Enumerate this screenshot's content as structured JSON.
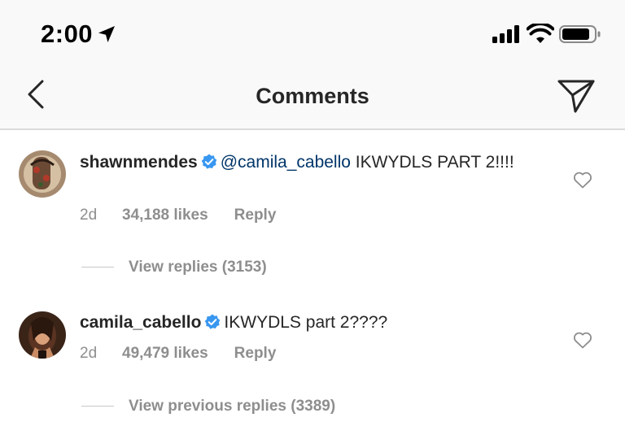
{
  "status_bar": {
    "time": "2:00",
    "icons": [
      "location-arrow-icon",
      "signal-bars-icon",
      "wifi-icon",
      "battery-icon"
    ]
  },
  "header": {
    "title": "Comments",
    "back_icon": "chevron-left-icon",
    "send_icon": "paper-plane-icon"
  },
  "comments": [
    {
      "username": "shawnmendes",
      "verified": true,
      "mention": "@camila_cabello",
      "text": " IKWYDLS PART 2!!!!",
      "age": "2d",
      "likes": "34,188 likes",
      "reply_label": "Reply",
      "replies_label": "View replies (3153)"
    },
    {
      "username": "camila_cabello",
      "verified": true,
      "mention": "",
      "text": "IKWYDLS part 2????",
      "age": "2d",
      "likes": "49,479 likes",
      "reply_label": "Reply",
      "replies_label": "View previous replies (3389)"
    }
  ],
  "colors": {
    "header_bg": "#f9f9f9",
    "text": "#262626",
    "muted": "#8e8e8e",
    "mention": "#003569",
    "verified": "#3897f0"
  }
}
